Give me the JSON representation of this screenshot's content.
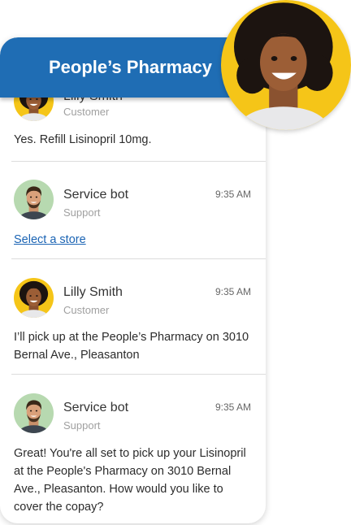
{
  "header": {
    "title": "People’s Pharmacy"
  },
  "messages": [
    {
      "name": "Lilly Smith",
      "role": "Customer",
      "time": "",
      "text": "Yes. Refill Lisinopril 10mg."
    },
    {
      "name": "Service bot",
      "role": "Support",
      "time": "9:35 AM",
      "link": "Select a store"
    },
    {
      "name": "Lilly Smith",
      "role": "Customer",
      "time": "9:35 AM",
      "text": "I’ll pick up at the People’s Pharmacy on 3010 Bernal Ave., Pleasanton"
    },
    {
      "name": "Service bot",
      "role": "Support",
      "time": "9:35 AM",
      "text": "Great! You're all set to pick up your Lisinopril at the People's Pharmacy on 3010 Bernal Ave., Pleasanton. How would you like to cover the copay?"
    }
  ],
  "colors": {
    "header": "#1f6db4",
    "link": "#1b64b4",
    "avatar_customer_bg": "#f5c518",
    "avatar_bot_bg": "#b7d9b0"
  },
  "icons": {
    "customer_avatar": "woman-portrait-avatar",
    "bot_avatar": "man-portrait-avatar"
  }
}
